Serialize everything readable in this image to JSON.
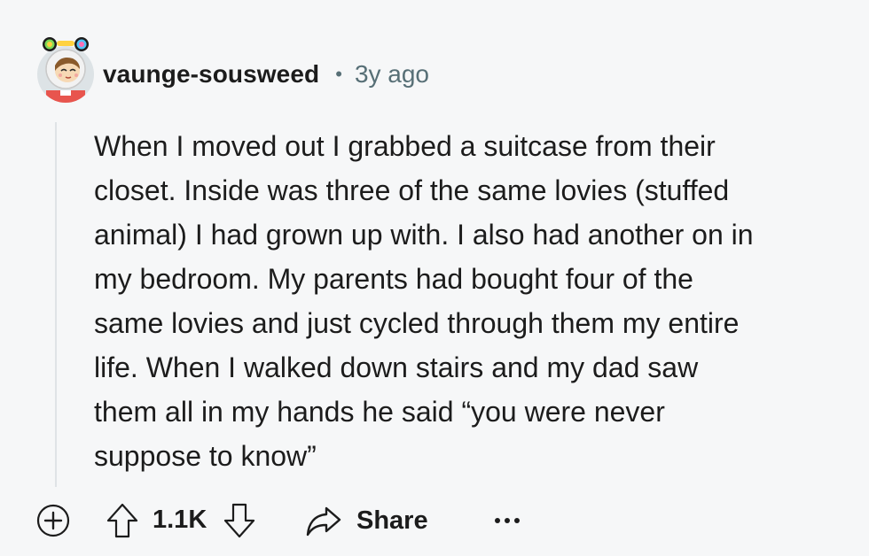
{
  "comment": {
    "author": "vaunge-sousweed",
    "separator": "•",
    "age": "3y ago",
    "body": [
      "When I moved out I grabbed a suitcase from their",
      "closet. Inside was three of the same lovies (stuffed",
      "animal) I had grown up with. I also had another on in",
      "my bedroom. My parents had bought four of the",
      "same lovies and just cycled through them my entire",
      "life. When I walked down stairs and my dad saw",
      "them all in my hands he said “you were never",
      "suppose to know”"
    ]
  },
  "actions": {
    "score": "1.1K",
    "share_label": "Share"
  },
  "icons": {
    "expand": "plus-circle-icon",
    "upvote": "arrow-up-icon",
    "downvote": "arrow-down-icon",
    "share": "share-arrow-icon",
    "more": "ellipsis-icon"
  },
  "colors": {
    "background": "#f6f7f8",
    "text": "#1c1c1c",
    "meta": "#576f76",
    "thread_line": "#dfe3e6"
  }
}
